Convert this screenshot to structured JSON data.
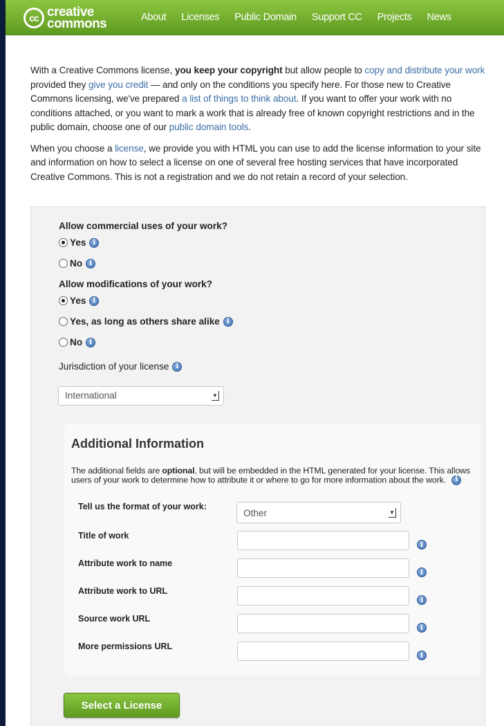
{
  "header": {
    "logo_top": "creative",
    "logo_bottom": "commons",
    "logo_badge": "cc",
    "nav": [
      "About",
      "Licenses",
      "Public Domain",
      "Support CC",
      "Projects",
      "News"
    ]
  },
  "intro": {
    "p1": {
      "t1": "With a Creative Commons license, ",
      "b1": "you keep your copyright",
      "t2": " but allow people to ",
      "l1": "copy and distribute your work",
      "t3": " provided they ",
      "l2": "give you credit",
      "t4": " — and only on the conditions you specify here. For those new to Creative Commons licensing, we've prepared ",
      "l3": "a list of things to think about",
      "t5": ". If you want to offer your work with no conditions attached, or you want to mark a work that is already free of known copyright restrictions and in the public domain, choose one of our ",
      "l4": "public domain tools",
      "t6": "."
    },
    "p2": {
      "t1": "When you choose a ",
      "l1": "license",
      "t2": ", we provide you with HTML you can use to add the license information to your site and information on how to select a license on one of several free hosting services that have incorporated Creative Commons. This is not a registration and we do not retain a record of your selection."
    }
  },
  "chooser": {
    "q_commercial": "Allow commercial uses of your work?",
    "commercial_options": [
      {
        "label": "Yes",
        "checked": true
      },
      {
        "label": "No",
        "checked": false
      }
    ],
    "q_modifications": "Allow modifications of your work?",
    "modification_options": [
      {
        "label": "Yes",
        "checked": true
      },
      {
        "label": "Yes, as long as others share alike",
        "checked": false
      },
      {
        "label": "No",
        "checked": false
      }
    ],
    "jurisdiction_label": "Jurisdiction of your license",
    "jurisdiction_value": "International",
    "info_glyph": "i"
  },
  "additional": {
    "title": "Additional Information",
    "desc_t1": "The additional fields are ",
    "desc_b": "optional",
    "desc_t2": ", but will be embedded in the HTML generated for your license. This allows users of your work to determine how to attribute it or where to go for more information about the work.",
    "format_label": "Tell us the format of your work:",
    "format_value": "Other",
    "fields": [
      "Title of work",
      "Attribute work to name",
      "Attribute work to URL",
      "Source work URL",
      "More permissions URL"
    ]
  },
  "button_label": "Select a License",
  "colors": {
    "brand_green": "#6fae2c",
    "link_blue": "#3a6ea5",
    "info_blue": "#3c6db0"
  }
}
